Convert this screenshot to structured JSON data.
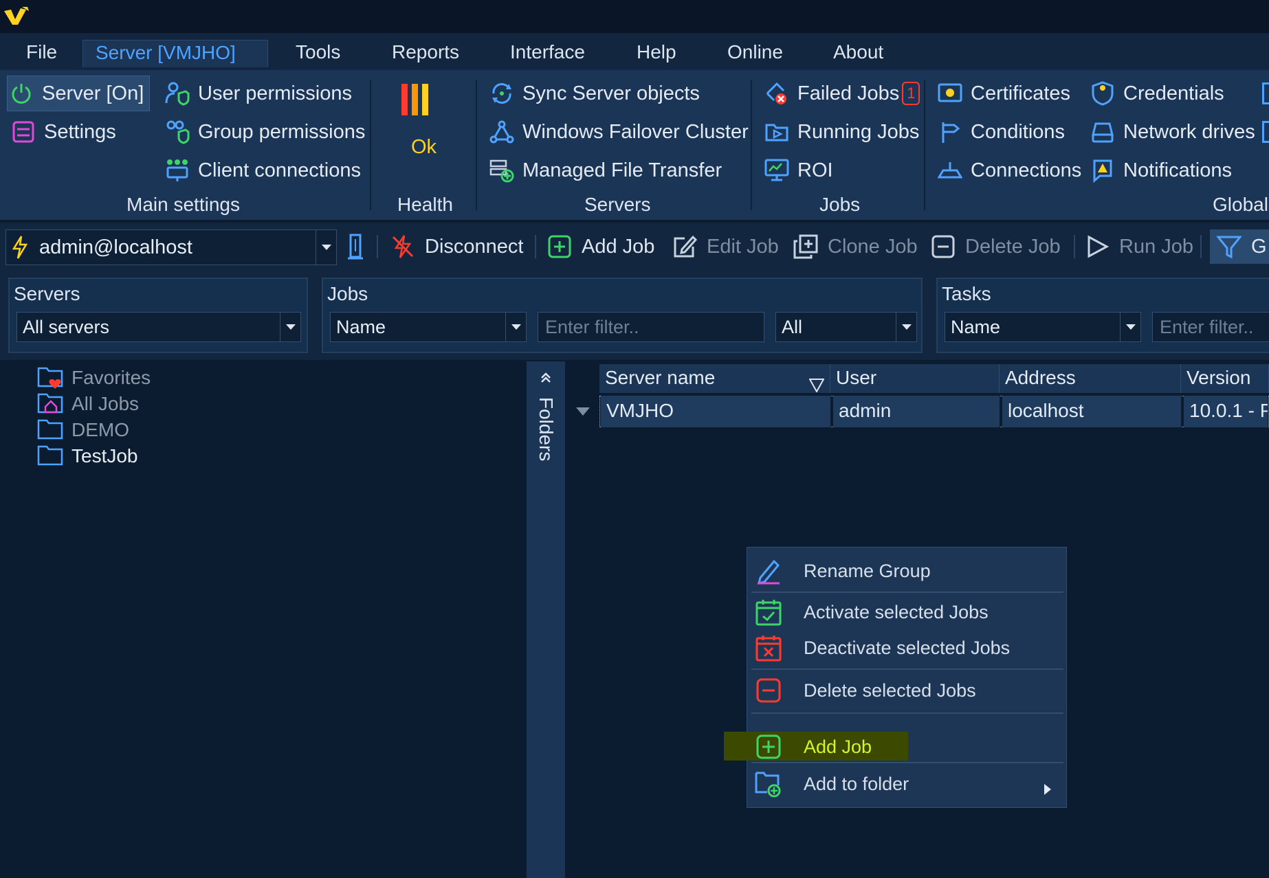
{
  "menu": [
    "File",
    "Server [VMJHO]",
    "Tools",
    "Reports",
    "Interface",
    "Help",
    "Online",
    "About"
  ],
  "ribbon": {
    "main_settings": {
      "server_on": "Server [On]",
      "settings": "Settings",
      "user_permissions": "User permissions",
      "group_permissions": "Group permissions",
      "client_connections": "Client connections",
      "label": "Main settings"
    },
    "health": {
      "status": "Ok",
      "label": "Health"
    },
    "servers": {
      "sync": "Sync Server objects",
      "failover": "Windows Failover Cluster",
      "mft": "Managed File Transfer",
      "label": "Servers"
    },
    "jobs": {
      "failed": "Failed Jobs",
      "failed_badge": "1",
      "running": "Running Jobs",
      "roi": "ROI",
      "label": "Jobs"
    },
    "global": {
      "certificates": "Certificates",
      "conditions": "Conditions",
      "connections": "Connections",
      "credentials": "Credentials",
      "network_drives": "Network drives",
      "notifications": "Notifications",
      "label": "Global"
    }
  },
  "toolbar": {
    "connection": "admin@localhost",
    "disconnect": "Disconnect",
    "add_job": "Add Job",
    "edit_job": "Edit Job",
    "clone_job": "Clone Job",
    "delete_job": "Delete Job",
    "run_job": "Run Job",
    "next_label": "G"
  },
  "filters": {
    "servers_label": "Servers",
    "servers_value": "All servers",
    "jobs_label": "Jobs",
    "jobs_field": "Name",
    "jobs_placeholder": "Enter filter..",
    "jobs_scope": "All",
    "tasks_label": "Tasks",
    "tasks_field": "Name",
    "tasks_placeholder": "Enter filter.."
  },
  "tree": [
    "Favorites",
    "All Jobs",
    "DEMO",
    "TestJob"
  ],
  "folders_tab": "Folders",
  "grid": {
    "headers": [
      "Server name",
      "User",
      "Address",
      "Version"
    ],
    "row": [
      "VMJHO",
      "admin",
      "localhost",
      "10.0.1 - P"
    ]
  },
  "context_menu": {
    "rename": "Rename Group",
    "activate": "Activate selected Jobs",
    "deactivate": "Deactivate selected Jobs",
    "delete": "Delete selected Jobs",
    "add_job": "Add Job",
    "add_to_folder": "Add to folder"
  },
  "colors": {
    "accent": "#4fa3ff",
    "highlight": "#3c4a00",
    "ok": "#ffd21f"
  }
}
